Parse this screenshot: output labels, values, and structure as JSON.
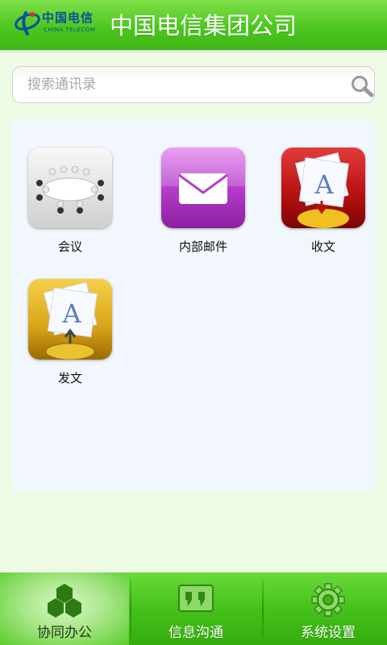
{
  "header": {
    "logo_cn": "中国电信",
    "logo_en": "CHINA TELECOM",
    "title": "中国电信集团公司"
  },
  "search": {
    "placeholder": "搜索通讯录",
    "icon": "search-icon"
  },
  "apps": [
    {
      "label": "会议",
      "icon": "meeting-icon"
    },
    {
      "label": "内部邮件",
      "icon": "mail-icon"
    },
    {
      "label": "收文",
      "icon": "receive-document-icon"
    },
    {
      "label": "发文",
      "icon": "send-document-icon"
    }
  ],
  "tabs": [
    {
      "label": "协同办公",
      "icon": "cubes-icon",
      "active": true
    },
    {
      "label": "信息沟通",
      "icon": "chat-quote-icon",
      "active": false
    },
    {
      "label": "系统设置",
      "icon": "gear-icon",
      "active": false
    }
  ],
  "colors": {
    "header_green": "#4cc71f",
    "page_background": "#eefbe4",
    "panel_background": "#f1f7fd",
    "brand_blue": "#0c4f9c"
  }
}
